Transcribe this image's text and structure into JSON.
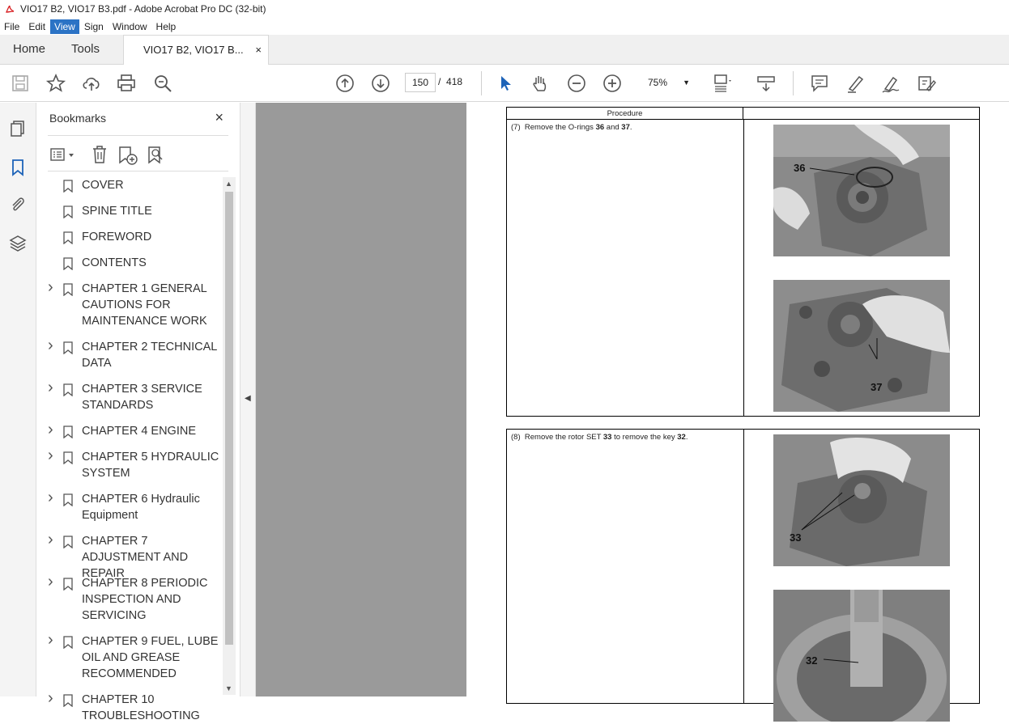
{
  "window": {
    "title": "VIO17 B2, VIO17 B3.pdf - Adobe Acrobat Pro DC (32-bit)"
  },
  "menu": {
    "items": [
      "File",
      "Edit",
      "View",
      "Sign",
      "Window",
      "Help"
    ],
    "active": "View"
  },
  "tabs": {
    "home": "Home",
    "tools": "Tools",
    "document": "VIO17 B2, VIO17 B...",
    "close": "×"
  },
  "toolbar": {
    "page_current": "150",
    "page_separator": "/",
    "page_total": "418",
    "zoom": "75%"
  },
  "bookmarks": {
    "title": "Bookmarks",
    "close": "×",
    "items": [
      {
        "label": "COVER",
        "expandable": false
      },
      {
        "label": "SPINE TITLE",
        "expandable": false
      },
      {
        "label": "FOREWORD",
        "expandable": false
      },
      {
        "label": "CONTENTS",
        "expandable": false
      },
      {
        "label": "CHAPTER 1 GENERAL CAUTIONS FOR MAINTENANCE WORK",
        "expandable": true
      },
      {
        "label": "CHAPTER 2 TECHNICAL DATA",
        "expandable": true
      },
      {
        "label": "CHAPTER 3 SERVICE STANDARDS",
        "expandable": true
      },
      {
        "label": "CHAPTER 4 ENGINE",
        "expandable": true
      },
      {
        "label": "CHAPTER 5 HYDRAULIC SYSTEM",
        "expandable": true
      },
      {
        "label": "CHAPTER 6 Hydraulic Equipment",
        "expandable": true
      },
      {
        "label": "CHAPTER 7 ADJUSTMENT AND REPAIR",
        "expandable": true
      },
      {
        "label": "CHAPTER 8 PERIODIC INSPECTION AND SERVICING",
        "expandable": true
      },
      {
        "label": "CHAPTER 9 FUEL, LUBE OIL AND GREASE RECOMMENDED",
        "expandable": true
      },
      {
        "label": "CHAPTER 10 TROUBLESHOOTING",
        "expandable": true
      }
    ]
  },
  "document": {
    "procedure_header": "Procedure",
    "step7": {
      "num": "(7)",
      "text_a": "Remove the O-rings ",
      "ref1": "36",
      "text_b": " and ",
      "ref2": "37",
      "text_c": "."
    },
    "step8": {
      "num": "(8)",
      "text_a": "Remove the rotor SET ",
      "ref1": "33",
      "text_b": " to remove the key ",
      "ref2": "32",
      "text_c": "."
    },
    "callouts": [
      "36",
      "37",
      "33",
      "32"
    ]
  }
}
